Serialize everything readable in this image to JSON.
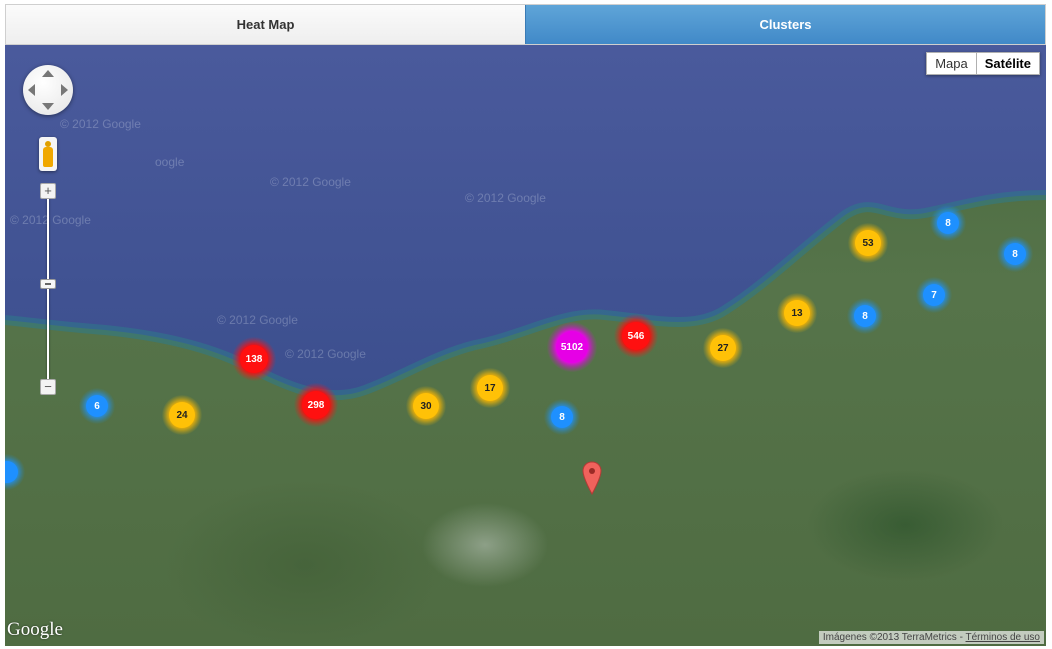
{
  "tabs": [
    {
      "label": "Heat Map",
      "active": false
    },
    {
      "label": "Clusters",
      "active": true
    }
  ],
  "map_type": {
    "options": [
      "Mapa",
      "Satélite"
    ],
    "selected": "Satélite"
  },
  "watermarks": [
    "© 2012 Google",
    "oogle",
    "© 2012 Google",
    "© 2012 Google",
    "© 2012 Google",
    "© 2012 Google",
    "© 2012 Google"
  ],
  "clusters": [
    {
      "count": "5102",
      "color": "magenta"
    },
    {
      "count": "546",
      "color": "red"
    },
    {
      "count": "298",
      "color": "red"
    },
    {
      "count": "138",
      "color": "red"
    },
    {
      "count": "53",
      "color": "yellow"
    },
    {
      "count": "30",
      "color": "yellow"
    },
    {
      "count": "27",
      "color": "yellow"
    },
    {
      "count": "24",
      "color": "yellow"
    },
    {
      "count": "17",
      "color": "yellow"
    },
    {
      "count": "13",
      "color": "yellow"
    },
    {
      "count": "8",
      "color": "blue"
    },
    {
      "count": "8",
      "color": "blue"
    },
    {
      "count": "8",
      "color": "blue"
    },
    {
      "count": "8",
      "color": "blue"
    },
    {
      "count": "7",
      "color": "blue"
    },
    {
      "count": "6",
      "color": "blue"
    },
    {
      "count": "",
      "color": "blue"
    }
  ],
  "colors": {
    "magenta": "#e600e6",
    "red": "#ff1010",
    "yellow": "#ffc107",
    "blue": "#1e90ff",
    "tab_active": "#4a90d0"
  },
  "logo": "Google",
  "attribution": {
    "text": "Imágenes ©2013 TerraMetrics -",
    "terms": "Términos de uso"
  }
}
